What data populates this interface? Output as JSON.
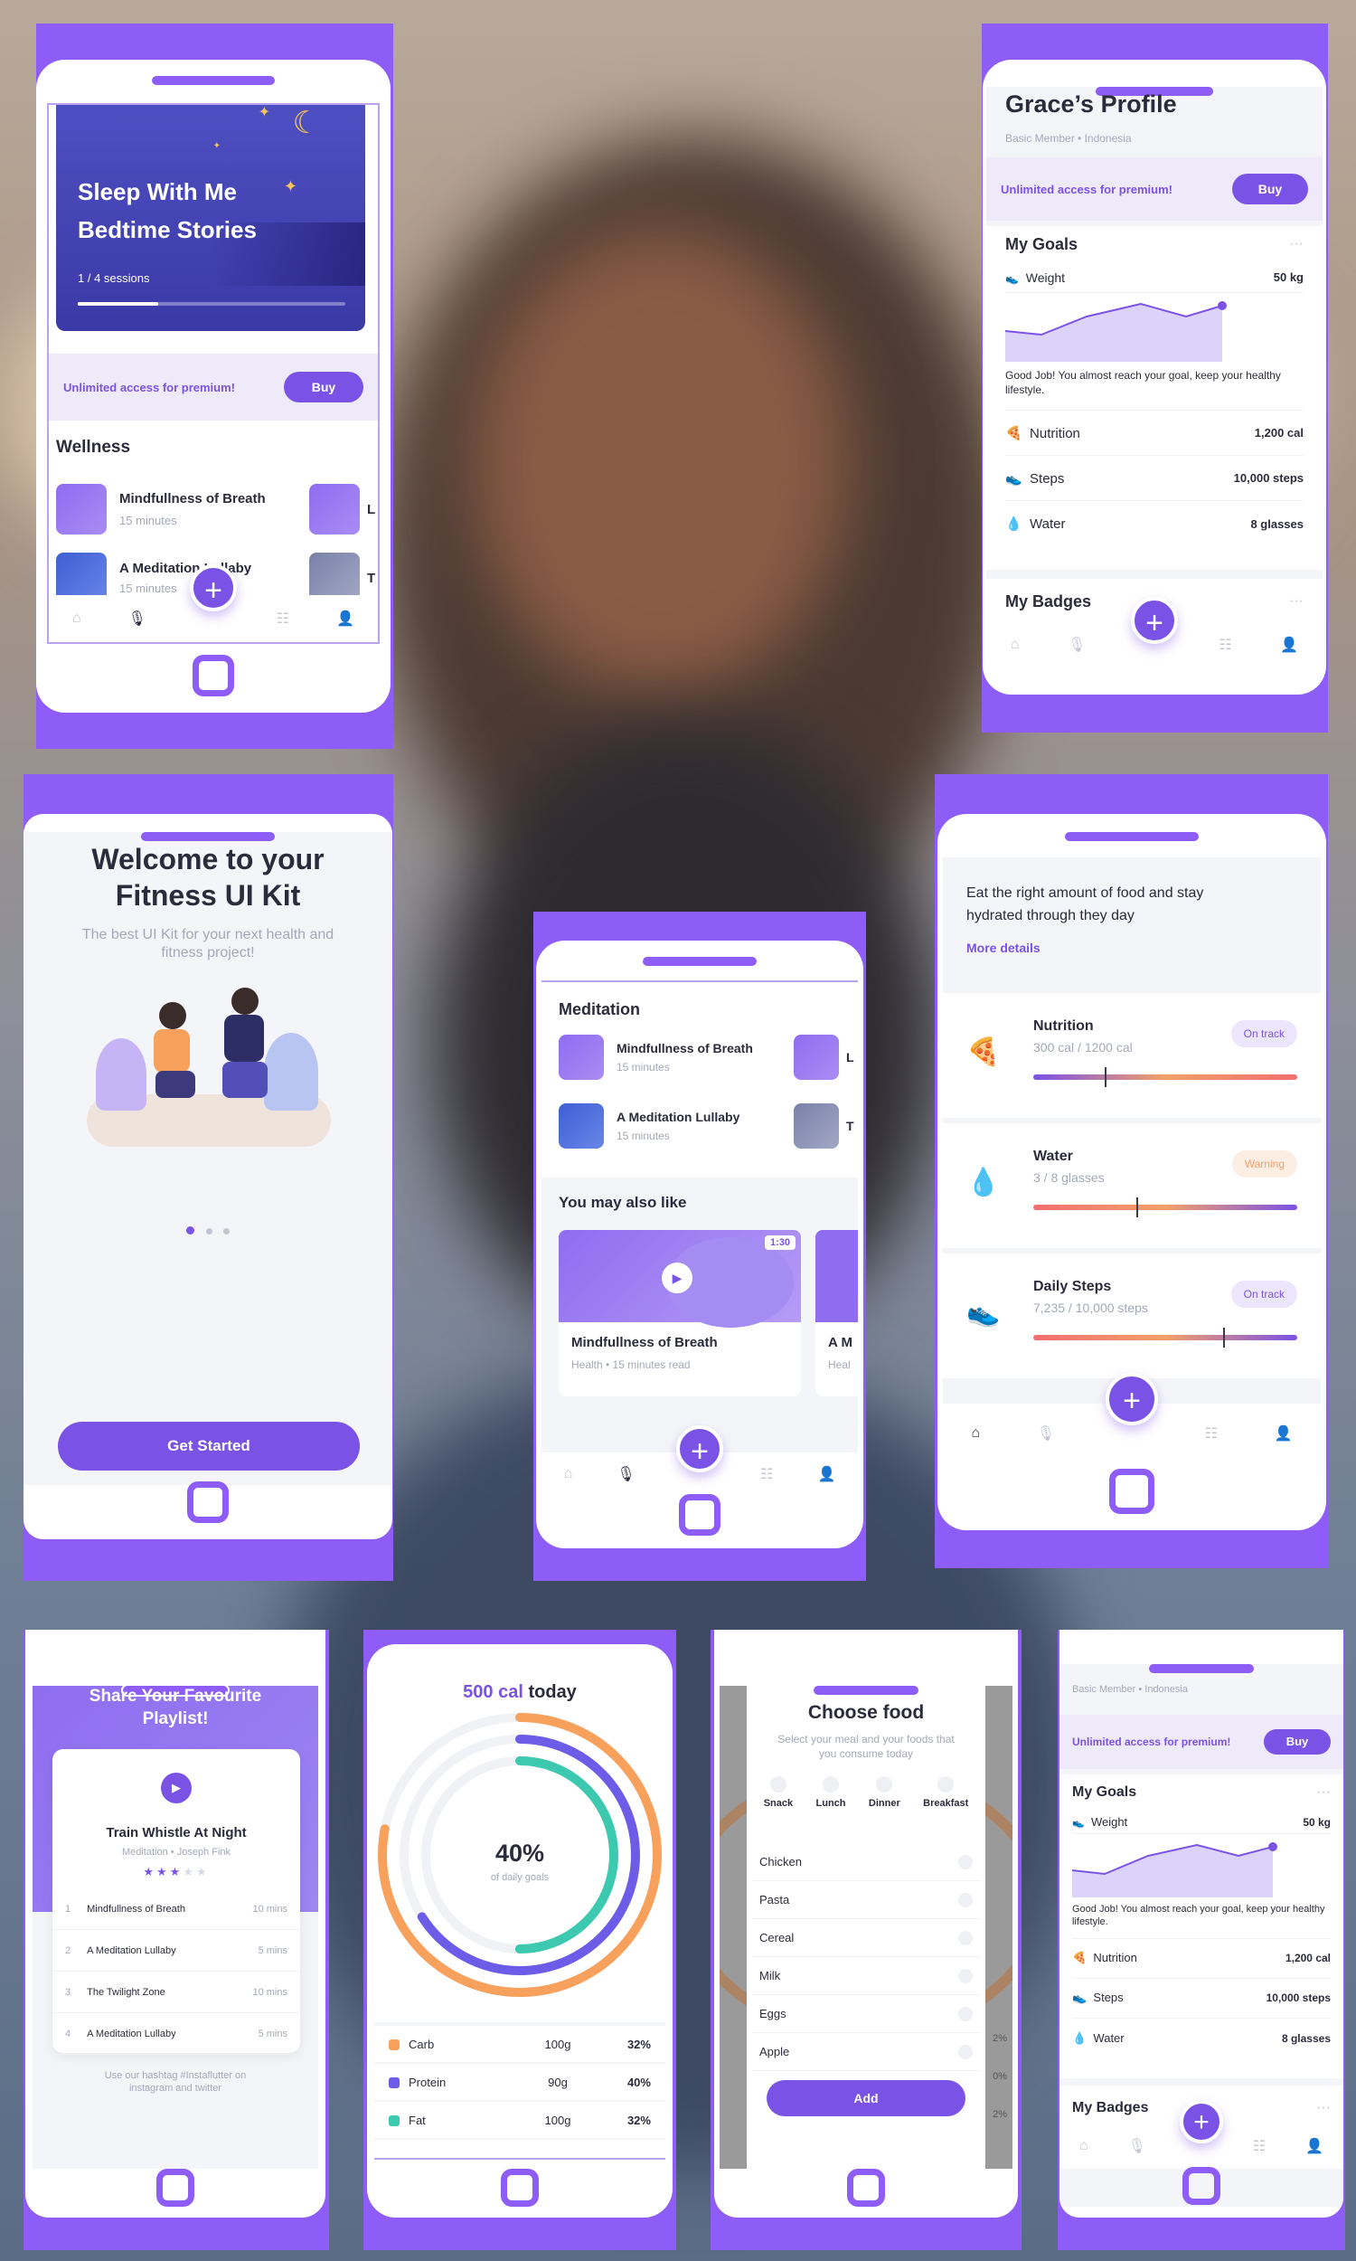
{
  "colors": {
    "accent": "#8e5cf6",
    "accent_dark": "#7b52e6",
    "orange": "#f7a15d",
    "teal": "#3dc9b0",
    "warning": "#f2a06a"
  },
  "sleep": {
    "hero_title_1": "Sleep With Me",
    "hero_title_2": "Bedtime Stories",
    "sessions": "1 / 4 sessions",
    "progress": 0.3,
    "premium_text": "Unlimited access for premium!",
    "buy": "Buy",
    "section": "Wellness",
    "items": [
      {
        "title": "Mindfullness of Breath",
        "sub": "15 minutes",
        "peek": "L"
      },
      {
        "title": "A Meditation Lullaby",
        "sub": "15 minutes",
        "peek": "T"
      }
    ]
  },
  "profile": {
    "name": "Grace’s Profile",
    "member": "Basic Member",
    "country": "Indonesia",
    "premium_text": "Unlimited access for premium!",
    "buy": "Buy",
    "goals_title": "My Goals",
    "more": "···",
    "weight_label": "Weight",
    "weight_value": "50 kg",
    "message": "Good Job! You almost reach your goal, keep your healthy lifestyle.",
    "stats": [
      {
        "icon": "🍕",
        "label": "Nutrition",
        "value": "1,200 cal"
      },
      {
        "icon": "👟",
        "label": "Steps",
        "value": "10,000 steps"
      },
      {
        "icon": "💧",
        "label": "Water",
        "value": "8 glasses"
      }
    ],
    "badges_title": "My Badges"
  },
  "welcome": {
    "title_1": "Welcome to your",
    "title_2": "Fitness UI Kit",
    "subtitle": "The best UI Kit for your next health and fitness project!",
    "cta": "Get Started"
  },
  "meditation": {
    "section": "Meditation",
    "items": [
      {
        "title": "Mindfullness of Breath",
        "sub": "15 minutes",
        "peek": "L"
      },
      {
        "title": "A Meditation Lullaby",
        "sub": "15 minutes",
        "peek": "T"
      }
    ],
    "also_like": "You may also like",
    "card_duration": "1:30",
    "card_title": "Mindfullness of Breath",
    "card_sub": "Health • 15 minutes read",
    "card2_title": "A M",
    "card2_sub": "Heal"
  },
  "tracker": {
    "intro": "Eat the right amount of food and stay hydrated through they day",
    "more": "More details",
    "items": [
      {
        "icon": "🍕",
        "title": "Nutrition",
        "sub": "300 cal / 1200 cal",
        "badge": "On track",
        "status": "ok",
        "marker": 0.27
      },
      {
        "icon": "💧",
        "title": "Water",
        "sub": "3 / 8 glasses",
        "badge": "Warning",
        "status": "warn",
        "marker": 0.39
      },
      {
        "icon": "👟",
        "title": "Daily Steps",
        "sub": "7,235 / 10,000 steps",
        "badge": "On track",
        "status": "ok",
        "marker": 0.72
      }
    ]
  },
  "playlist": {
    "header_1": "Share Your Favourite",
    "header_2": "Playlist!",
    "track": "Train Whistle At Night",
    "category": "Meditation",
    "artist": "Joseph Fink",
    "rating": 3,
    "tracks": [
      {
        "n": "1",
        "title": "Mindfullness of Breath",
        "dur": "10 mins"
      },
      {
        "n": "2",
        "title": "A Meditation Lullaby",
        "dur": "5 mins"
      },
      {
        "n": "3",
        "title": "The Twilight Zone",
        "dur": "10 mins"
      },
      {
        "n": "4",
        "title": "A Meditation Lullaby",
        "dur": "5 mins"
      }
    ],
    "footer_1": "Use our hashtag #Instaflutter on",
    "footer_2": "instagram and twitter"
  },
  "calories": {
    "headline_accent": "500 cal",
    "headline_rest": "today",
    "percent": "40%",
    "percent_sub": "of daily goals",
    "rings": [
      0.78,
      0.66,
      0.5
    ],
    "macros": [
      {
        "name": "Carb",
        "grams": "100g",
        "pct": "32%",
        "color": "#f7a15d"
      },
      {
        "name": "Protein",
        "grams": "90g",
        "pct": "40%",
        "color": "#6c5ce7"
      },
      {
        "name": "Fat",
        "grams": "100g",
        "pct": "32%",
        "color": "#3dc9b0"
      }
    ]
  },
  "food": {
    "title": "Choose food",
    "subtitle": "Select your meal and your foods that you consume today",
    "meals": [
      "Snack",
      "Lunch",
      "Dinner",
      "Breakfast"
    ],
    "foods": [
      "Chicken",
      "Pasta",
      "Cereal",
      "Milk",
      "Eggs",
      "Apple"
    ],
    "add": "Add",
    "peek_right": [
      "2%",
      "0%",
      "2%"
    ]
  },
  "profile2": {
    "member": "Basic Member",
    "country": "Indonesia",
    "premium_text": "Unlimited access for premium!",
    "buy": "Buy",
    "goals_title": "My Goals",
    "more": "···",
    "weight_label": "Weight",
    "weight_value": "50 kg",
    "message": "Good Job! You almost reach your goal, keep your healthy lifestyle.",
    "stats": [
      {
        "icon": "🍕",
        "label": "Nutrition",
        "value": "1,200 cal"
      },
      {
        "icon": "👟",
        "label": "Steps",
        "value": "10,000 steps"
      },
      {
        "icon": "💧",
        "label": "Water",
        "value": "8 glasses"
      }
    ],
    "badges_title": "My Badges"
  },
  "nav": {
    "home": "⌂",
    "mic": "🎙",
    "plus": "+",
    "list": "☷",
    "user": "👤"
  }
}
